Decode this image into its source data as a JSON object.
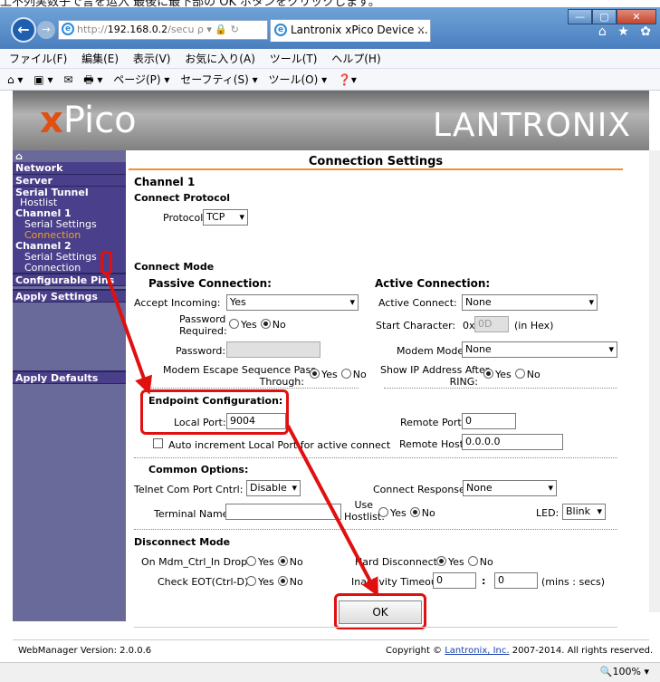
{
  "caption": "上不列実数子で言を运入 最後に最下部の OK ボタンをクリックします。",
  "browser": {
    "address_prefix": "http://",
    "address_host": "192.168.0.2",
    "address_path": "/secu",
    "address_icons": "ρ ▾ 🔒 ↻",
    "tab_title": "Lantronix xPico Device ...",
    "tab_close": "×",
    "window_controls": [
      "—",
      "▢",
      "✕"
    ],
    "right_icons": "⌂ ★ ✿",
    "menu": [
      "ファイル(F)",
      "編集(E)",
      "表示(V)",
      "お気に入り(A)",
      "ツール(T)",
      "ヘルプ(H)"
    ],
    "commands": [
      "⌂ ▾",
      "▣ ▾",
      "✉",
      "🖶 ▾",
      "ページ(P) ▾",
      "セーフティ(S) ▾",
      "ツール(O) ▾",
      "❓▾"
    ]
  },
  "banner": {
    "product_x": "x",
    "product_rest": "Pico",
    "brand": "LANTRONIX"
  },
  "sidebar": {
    "home": "⌂",
    "network": "Network",
    "server": "Server",
    "serial_tunnel": "Serial Tunnel",
    "hostlist": "Hostlist",
    "channel1": "Channel 1",
    "ch1_serial": "Serial Settings",
    "ch1_connection": "Connection",
    "channel2": "Channel 2",
    "ch2_serial": "Serial Settings",
    "ch2_connection": "Connection",
    "config_pins": "Configurable Pins",
    "apply_settings": "Apply Settings",
    "apply_defaults": "Apply Defaults"
  },
  "page": {
    "title": "Connection Settings",
    "channel": "Channel 1",
    "connect_protocol": "Connect Protocol",
    "protocol_label": "Protocol:",
    "protocol_value": "TCP",
    "connect_mode": "Connect Mode",
    "passive": "Passive Connection:",
    "active": "Active Connection:",
    "accept_incoming_label": "Accept Incoming:",
    "accept_incoming_value": "Yes",
    "active_connect_label": "Active Connect:",
    "active_connect_value": "None",
    "password_required_label1": "Password",
    "password_required_label2": "Required:",
    "yes": "Yes",
    "no": "No",
    "start_char_label": "Start Character:",
    "start_char_prefix": "0x",
    "start_char_value": "0D",
    "start_char_suffix": "(in Hex)",
    "password_label": "Password:",
    "modem_mode_label": "Modem Mode:",
    "modem_mode_value": "None",
    "modem_escape_label1": "Modem Escape Sequence Pass",
    "modem_escape_label2": "Through:",
    "show_ip_label1": "Show IP Address After",
    "show_ip_label2": "RING:",
    "endpoint": "Endpoint Configuration:",
    "local_port_label": "Local Port:",
    "local_port_value": "9004",
    "remote_port_label": "Remote Port:",
    "remote_port_value": "0",
    "auto_increment": "Auto increment Local Port for active connect",
    "remote_host_label": "Remote Host:",
    "remote_host_value": "0.0.0.0",
    "common_options": "Common Options:",
    "telnet_label": "Telnet Com Port Cntrl:",
    "telnet_value": "Disable",
    "connect_response_label": "Connect Response:",
    "connect_response_value": "None",
    "terminal_name_label": "Terminal Name:",
    "use_hostlist_label1": "Use",
    "use_hostlist_label2": "Hostlist:",
    "led_label": "LED:",
    "led_value": "Blink",
    "disconnect_mode": "Disconnect Mode",
    "mdm_ctrl_label": "On Mdm_Ctrl_In Drop:",
    "hard_disconnect_label": "Hard Disconnect:",
    "check_eot_label": "Check EOT(Ctrl-D):",
    "inactivity_label": "Inactivity Timeout:",
    "inactivity_min": "0",
    "inactivity_sep": ":",
    "inactivity_sec": "0",
    "inactivity_units": "(mins : secs)",
    "ok": "OK"
  },
  "footer": {
    "version": "WebManager Version: 2.0.0.6",
    "copyright_pre": "Copyright © ",
    "copyright_link": "Lantronix, Inc.",
    "copyright_post": " 2007-2014. All rights reserved."
  },
  "status": {
    "zoom": "🔍100%  ▾"
  },
  "colors": {
    "highlight": "#e01010",
    "sidebar": "#4a3f8a",
    "active_link": "#f0a020",
    "header_rule": "#f09030"
  }
}
